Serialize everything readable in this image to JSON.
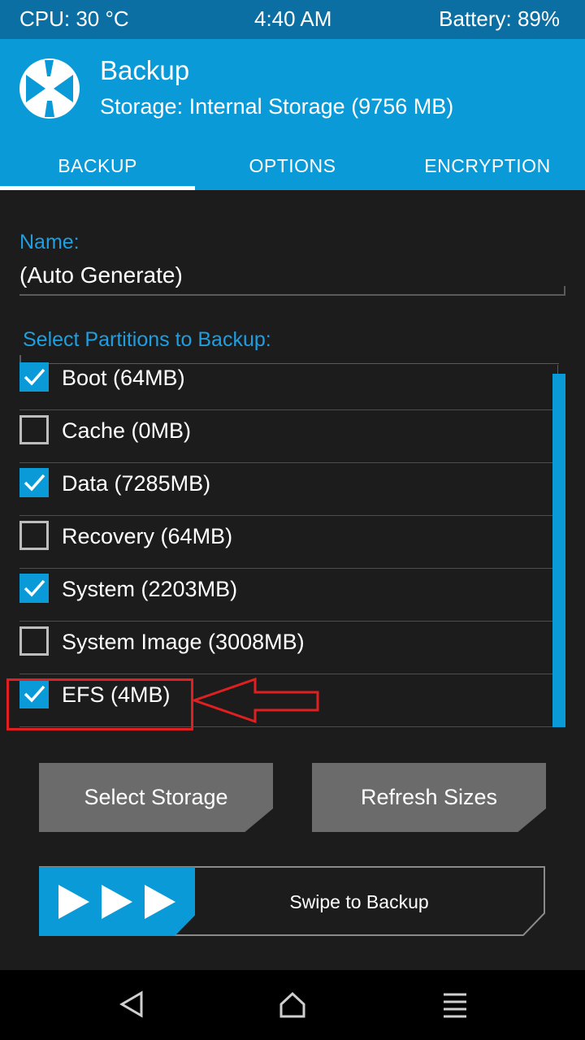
{
  "status_bar": {
    "cpu": "CPU: 30 °C",
    "time": "4:40 AM",
    "battery": "Battery: 89%"
  },
  "header": {
    "title": "Backup",
    "storage": "Storage: Internal Storage (9756 MB)"
  },
  "tabs": [
    {
      "label": "BACKUP",
      "active": true
    },
    {
      "label": "OPTIONS",
      "active": false
    },
    {
      "label": "ENCRYPTION",
      "active": false
    }
  ],
  "name_field": {
    "label": "Name:",
    "value": "(Auto Generate)"
  },
  "partitions": {
    "heading": "Select Partitions to Backup:",
    "items": [
      {
        "label": "Boot (64MB)",
        "checked": true
      },
      {
        "label": "Cache (0MB)",
        "checked": false
      },
      {
        "label": "Data (7285MB)",
        "checked": true
      },
      {
        "label": "Recovery (64MB)",
        "checked": false
      },
      {
        "label": "System (2203MB)",
        "checked": true
      },
      {
        "label": "System Image (3008MB)",
        "checked": false
      },
      {
        "label": "EFS (4MB)",
        "checked": true
      }
    ]
  },
  "buttons": {
    "select_storage": "Select Storage",
    "refresh_sizes": "Refresh Sizes"
  },
  "swipe": {
    "label": "Swipe to Backup"
  },
  "colors": {
    "accent": "#0a9ad7",
    "status_bar": "#0b6fa3",
    "background": "#1c1c1c",
    "highlight": "#e02020"
  },
  "icons": [
    "twrp-logo-icon",
    "checkmark-icon",
    "play-arrow-icon",
    "back-icon",
    "home-icon",
    "menu-icon",
    "red-arrow-icon"
  ]
}
